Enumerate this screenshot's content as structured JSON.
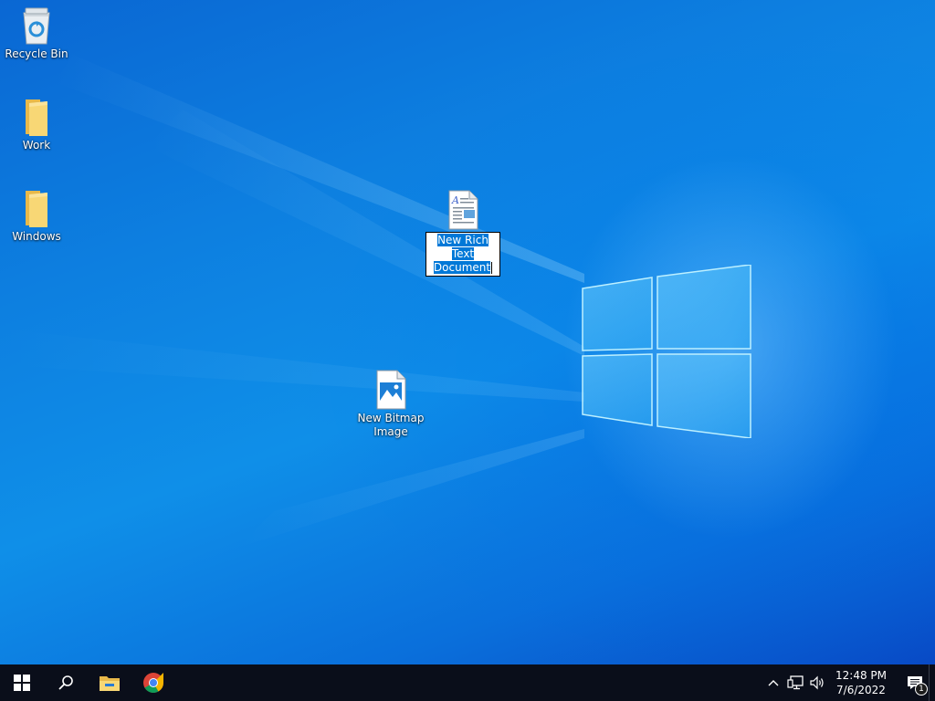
{
  "desktop": {
    "icons": [
      {
        "label": "Recycle Bin",
        "icon": "recycle-bin-icon"
      },
      {
        "label": "Work",
        "icon": "folder-icon"
      },
      {
        "label": "Windows",
        "icon": "folder-icon"
      },
      {
        "label_line1": "New Rich Text",
        "label_line2": "Document",
        "icon": "rich-text-document-icon",
        "state": "renaming"
      },
      {
        "label": "New Bitmap Image",
        "icon": "bitmap-image-icon"
      }
    ]
  },
  "taskbar": {
    "clock": {
      "time": "12:48 PM",
      "date": "7/6/2022"
    },
    "notification_count": "1",
    "colors": {
      "background": "#0a0e1a",
      "accent": "#0078d7"
    }
  }
}
